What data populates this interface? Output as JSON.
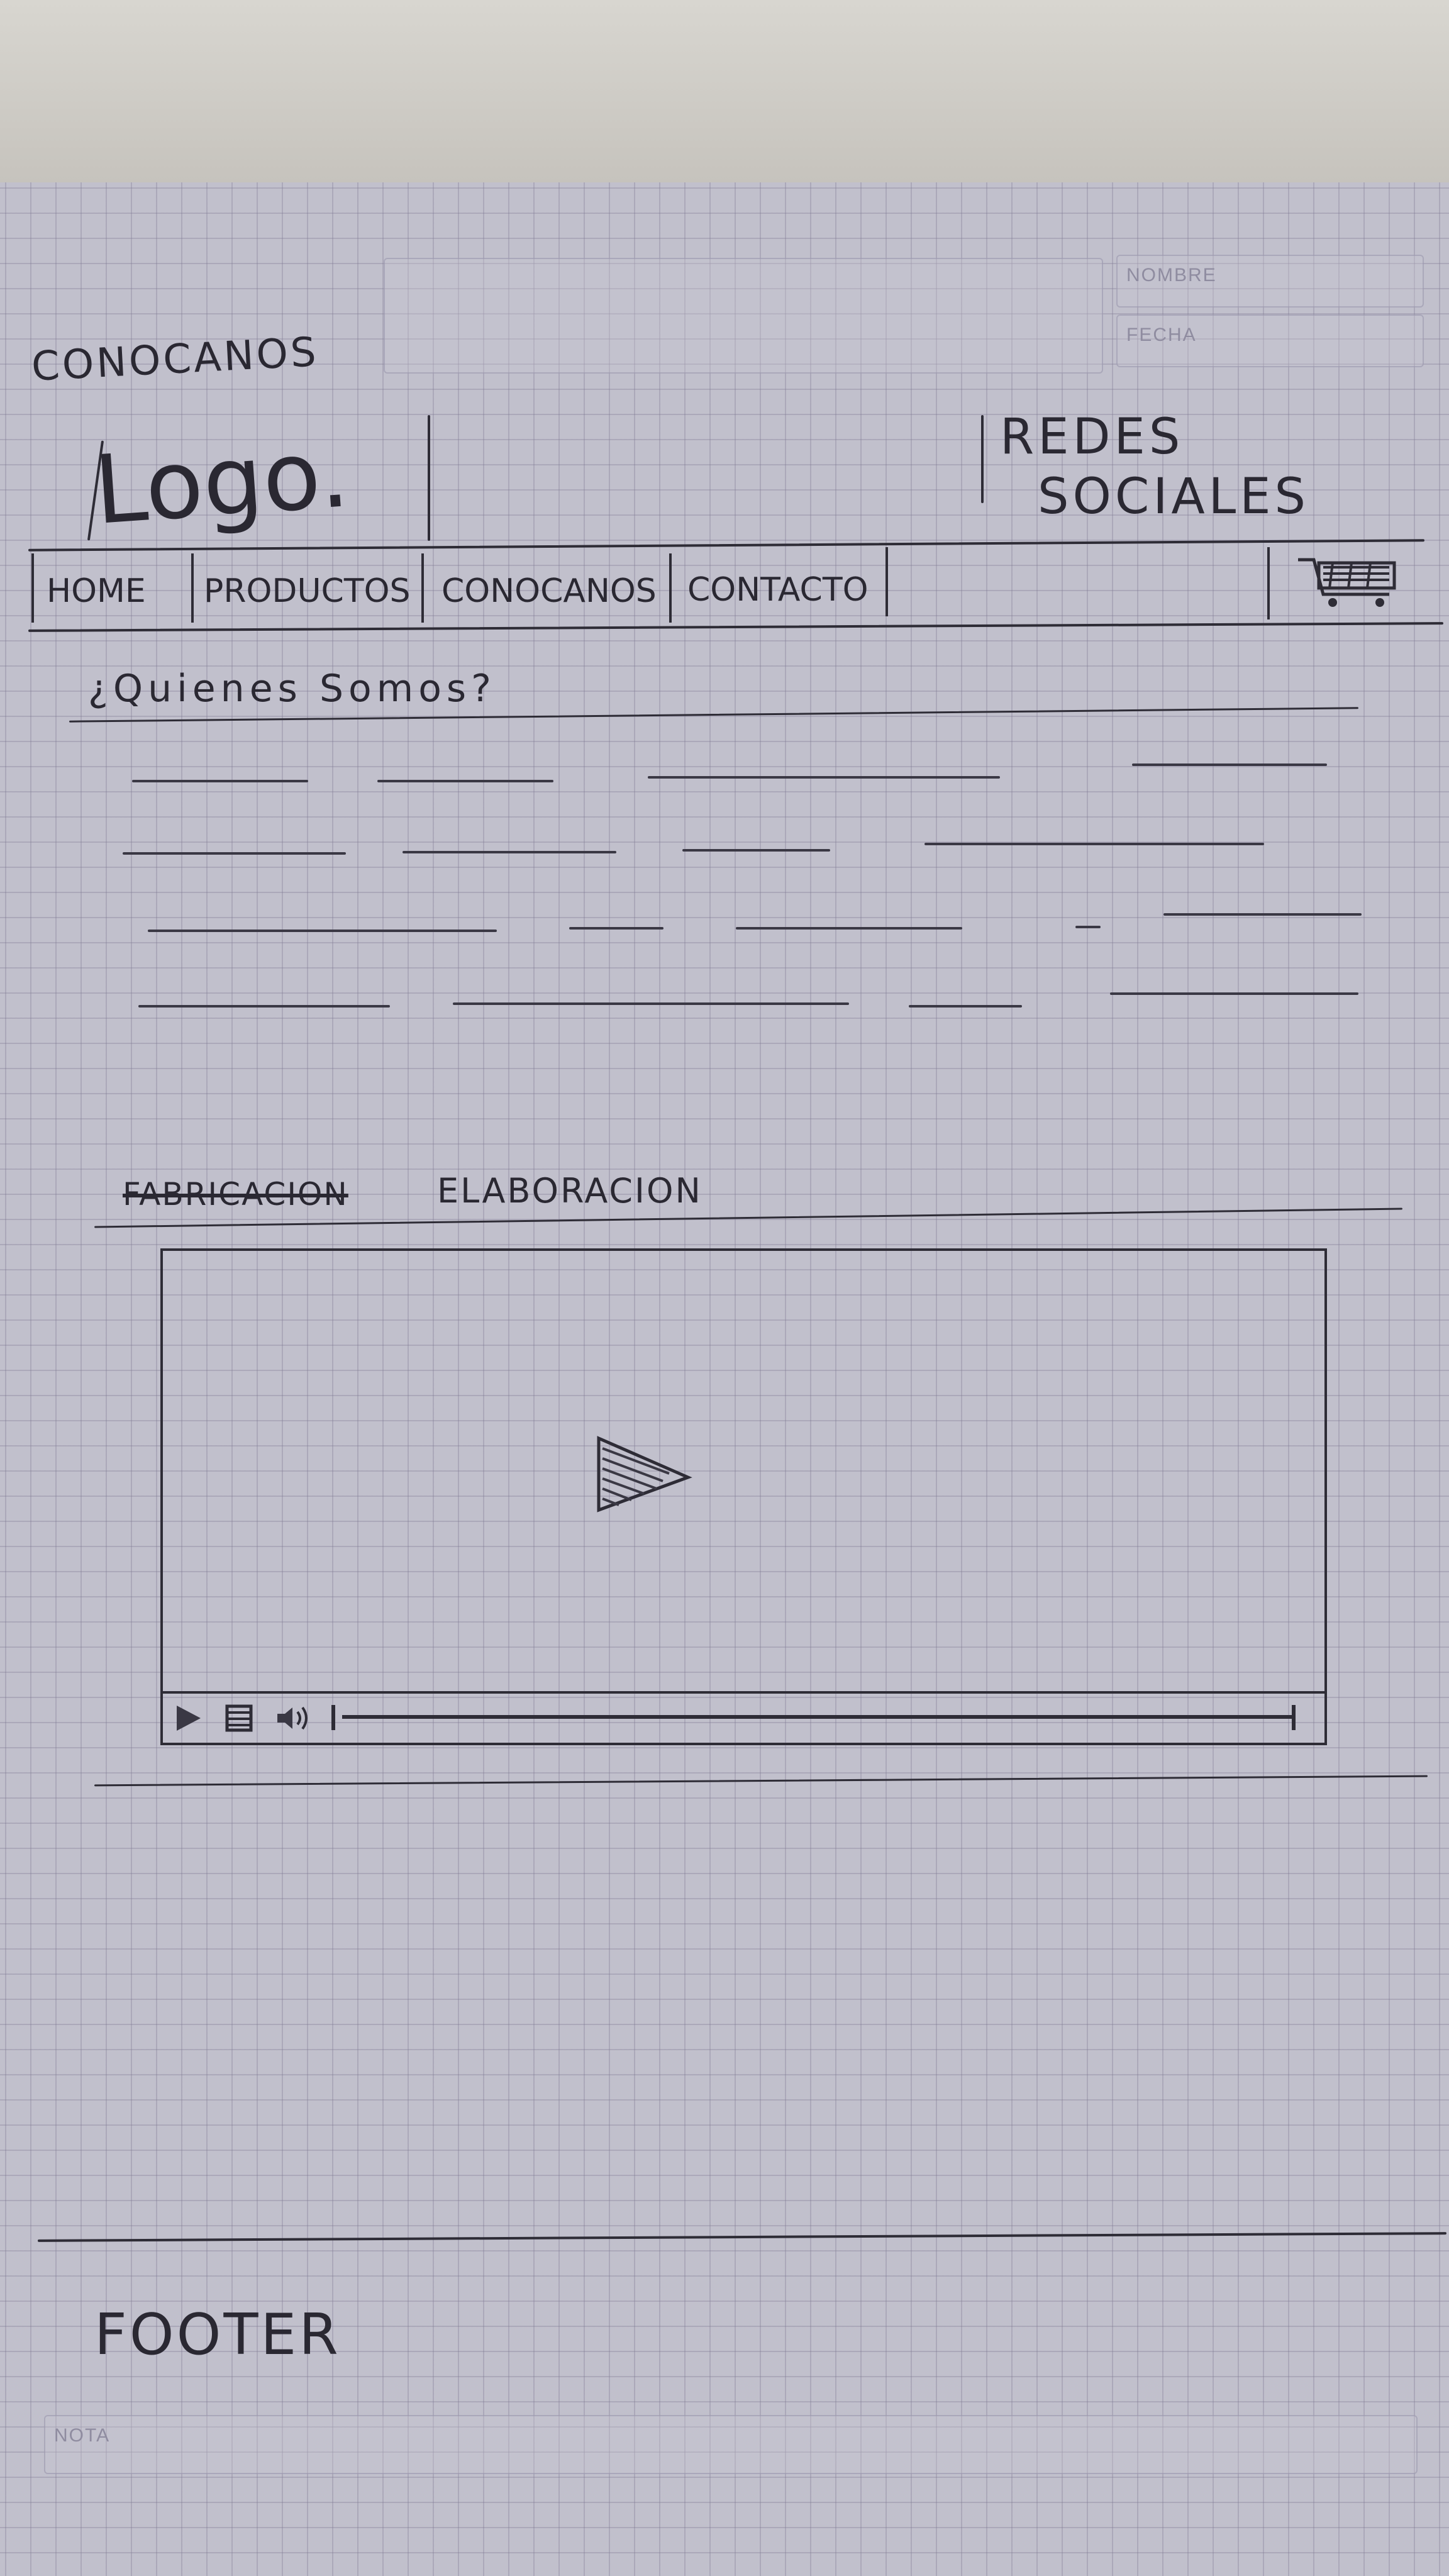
{
  "sheet": {
    "name_label": "NOMBRE",
    "date_label": "FECHA",
    "note_label": "NOTA"
  },
  "sketch": {
    "page_label": "Conocanos",
    "logo": "Logo.",
    "social": {
      "line1": "Redes",
      "line2": "sociales"
    },
    "nav": {
      "items": [
        {
          "label": "Home"
        },
        {
          "label": "Productos"
        },
        {
          "label": "Conocanos"
        },
        {
          "label": "Contacto"
        }
      ],
      "cart_icon": "shopping-cart-icon"
    },
    "about": {
      "heading": "¿Quienes Somos?"
    },
    "video_section": {
      "heading_struck": "Fabricacion",
      "heading": "Elaboracion",
      "icons": [
        "play-icon",
        "stop-icon",
        "volume-icon",
        "seek-start-icon"
      ]
    },
    "footer": {
      "label": "Footer"
    }
  }
}
